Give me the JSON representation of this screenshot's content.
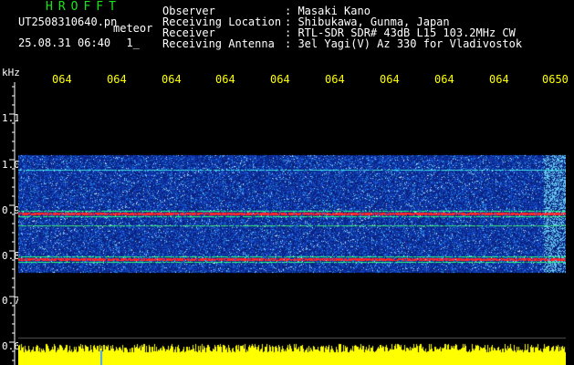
{
  "header": {
    "app_title": "HROFFT",
    "filename": "UT2508310640.pn",
    "tag": "meteor",
    "date_time": "25.08.31 06:40",
    "mode": "1_",
    "info_labels": [
      "Observer",
      "Receiving Location",
      "Receiver",
      "Receiving Antenna"
    ],
    "info_values": [
      ": Masaki Kano",
      ": Shibukawa, Gunma, Japan",
      ": RTL-SDR SDR# 43dB L15 103.2MHz CW",
      ": 3el Yagi(V) Az 330 for Vladivostok"
    ]
  },
  "axis": {
    "unit": "kHz",
    "x_ticks": [
      "064",
      "064",
      "064",
      "064",
      "064",
      "064",
      "064",
      "064",
      "064",
      "0650"
    ],
    "y_ticks": [
      "1.1",
      "1.0",
      "0.9",
      "0.8",
      "0.7",
      "0.6"
    ]
  },
  "colors": {
    "background": "#000000",
    "tick_text": "#ffff00",
    "app_title": "#19e619",
    "noise_floor": "#0a2a8a",
    "signal_line": "#ff2020",
    "signal_edge": "#20ff60",
    "power_bar": "#ffff00"
  }
}
